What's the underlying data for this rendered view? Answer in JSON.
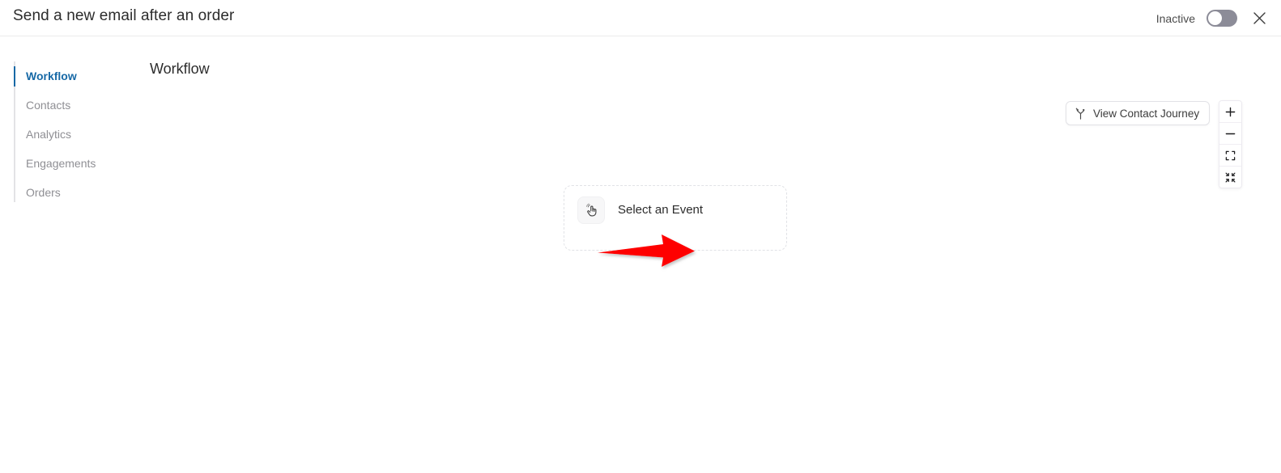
{
  "header": {
    "title": "Send a new email after an order",
    "status_label": "Inactive",
    "toggle_state": "off",
    "close_icon": "close-icon"
  },
  "sidebar": {
    "active_index": 0,
    "items": [
      {
        "label": "Workflow"
      },
      {
        "label": "Contacts"
      },
      {
        "label": "Analytics"
      },
      {
        "label": "Engagements"
      },
      {
        "label": "Orders"
      }
    ]
  },
  "main": {
    "section_title": "Workflow",
    "journey_button": {
      "label": "View Contact Journey",
      "icon": "branch-journey-icon"
    },
    "zoom_controls": [
      {
        "name": "zoom-in-button",
        "icon": "plus-icon"
      },
      {
        "name": "zoom-out-button",
        "icon": "minus-icon"
      },
      {
        "name": "fit-view-button",
        "icon": "expand-corners-icon"
      },
      {
        "name": "center-view-button",
        "icon": "collapse-arrows-icon"
      }
    ],
    "event_node": {
      "label": "Select an Event",
      "icon": "tap-hand-icon"
    },
    "annotation": {
      "type": "arrow",
      "direction": "right",
      "color": "#fe0000"
    }
  },
  "colors": {
    "accent_blue": "#1769a6",
    "muted_text": "#8f8f94",
    "annotation_red": "#fe0000",
    "toggle_off": "#8c8c98"
  }
}
